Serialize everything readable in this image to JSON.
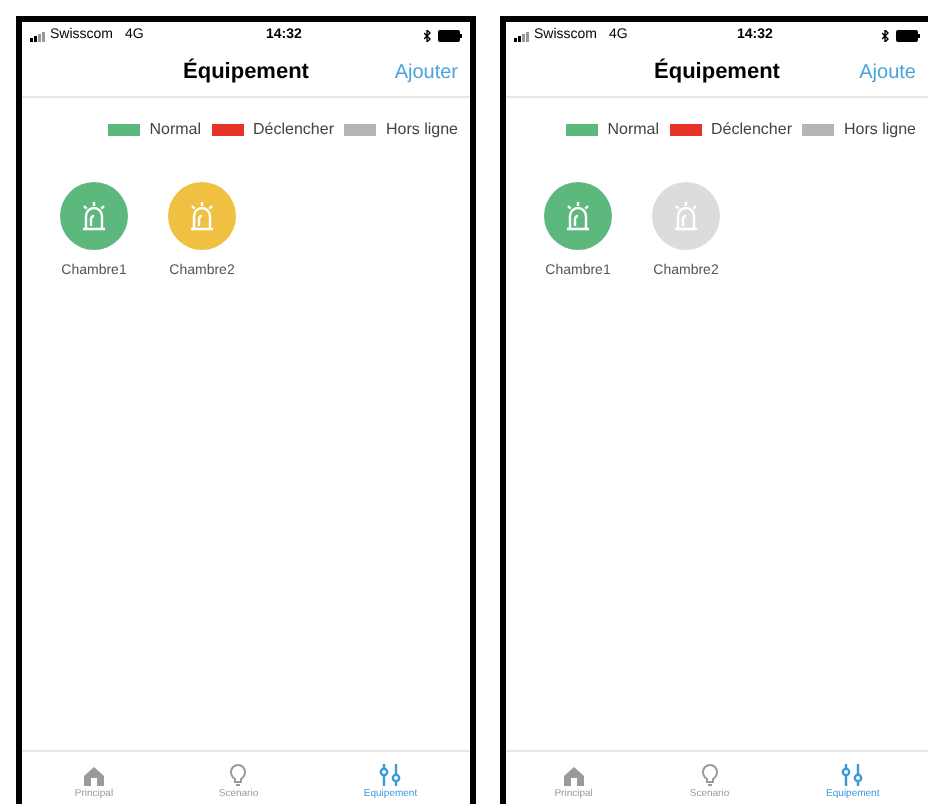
{
  "screens": [
    {
      "status_bar": {
        "carrier": "Swisscom",
        "network": "4G",
        "time": "14:32"
      },
      "title": "Équipement",
      "action": "Ajouter",
      "legend": [
        {
          "label": "Normal",
          "color": "#5cb87c"
        },
        {
          "label": "Déclencher",
          "color": "#e5332a"
        },
        {
          "label": "Hors ligne",
          "color": "#b5b5b5"
        }
      ],
      "devices": [
        {
          "name": "Chambre1",
          "color": "#5cb87c"
        },
        {
          "name": "Chambre2",
          "color": "#f0c043"
        }
      ],
      "tabs": [
        {
          "label": "Principal",
          "selected": false
        },
        {
          "label": "Scenario",
          "selected": false
        },
        {
          "label": "Equipement",
          "selected": true
        }
      ]
    },
    {
      "status_bar": {
        "carrier": "Swisscom",
        "network": "4G",
        "time": "14:32"
      },
      "title": "Équipement",
      "action": "Ajoute",
      "legend": [
        {
          "label": "Normal",
          "color": "#5cb87c"
        },
        {
          "label": "Déclencher",
          "color": "#e5332a"
        },
        {
          "label": "Hors ligne",
          "color": "#b5b5b5"
        }
      ],
      "devices": [
        {
          "name": "Chambre1",
          "color": "#5cb87c"
        },
        {
          "name": "Chambre2",
          "color": "#dcdcdc"
        }
      ],
      "tabs": [
        {
          "label": "Principal",
          "selected": false
        },
        {
          "label": "Scenario",
          "selected": false
        },
        {
          "label": "Equipement",
          "selected": true
        }
      ]
    }
  ]
}
